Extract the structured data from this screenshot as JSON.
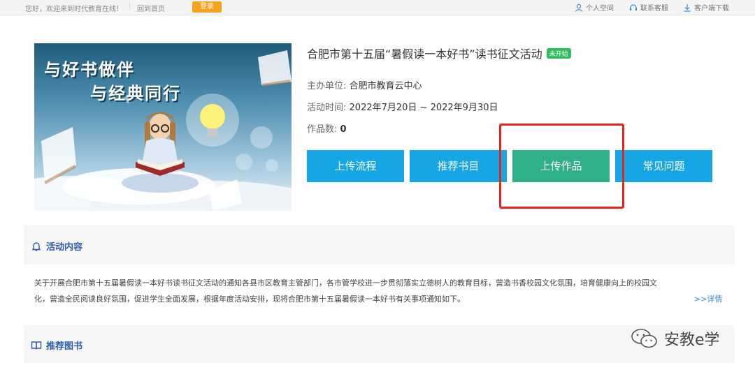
{
  "topbar": {
    "welcome": "您好，欢迎来到时代教育在线！",
    "separator": "|",
    "home": "回到首页",
    "login": "登录",
    "personal": "个人空间",
    "service": "联系客服",
    "download": "客户端下载"
  },
  "cover": {
    "line1": "与好书做伴",
    "line2": "与经典同行"
  },
  "activity": {
    "title": "合肥市第十五届“暑假读一本好书”读书征文活动",
    "status": "未开始",
    "organizer_label": "主办单位:",
    "organizer": "合肥市教育云中心",
    "time_label": "活动时间:",
    "time": "2022年7月20日 ~ 2022年9月30日",
    "count_label": "作品数:",
    "count": "0"
  },
  "buttons": {
    "flow": "上传流程",
    "books": "推荐书目",
    "upload": "上传作品",
    "faq": "常见问题"
  },
  "content": {
    "heading": "活动内容",
    "line1": "关于开展合肥市第十五届暑假读一本好书读书征文活动的通知各县市区教育主管部门，各市管学校进一步贯彻落实立德树人的教育目标，营造书香校园文化氛围，培育健康向上的校园文",
    "line2": "化，营造全民阅读良好氛围，促进学生全面发展，根据年度活动安排，现将合肥市第十五届暑假读一本好书有关事项通知如下。",
    "more": ">>详情"
  },
  "books_section": {
    "heading": "推荐图书"
  },
  "watermark": {
    "text": "安教e学"
  },
  "colors": {
    "primary_button": "#16a6e6",
    "upload_button": "#2fb089",
    "highlight_box": "#e8241a",
    "login_button": "#f7a21b",
    "section_heading": "#2e5da8"
  }
}
